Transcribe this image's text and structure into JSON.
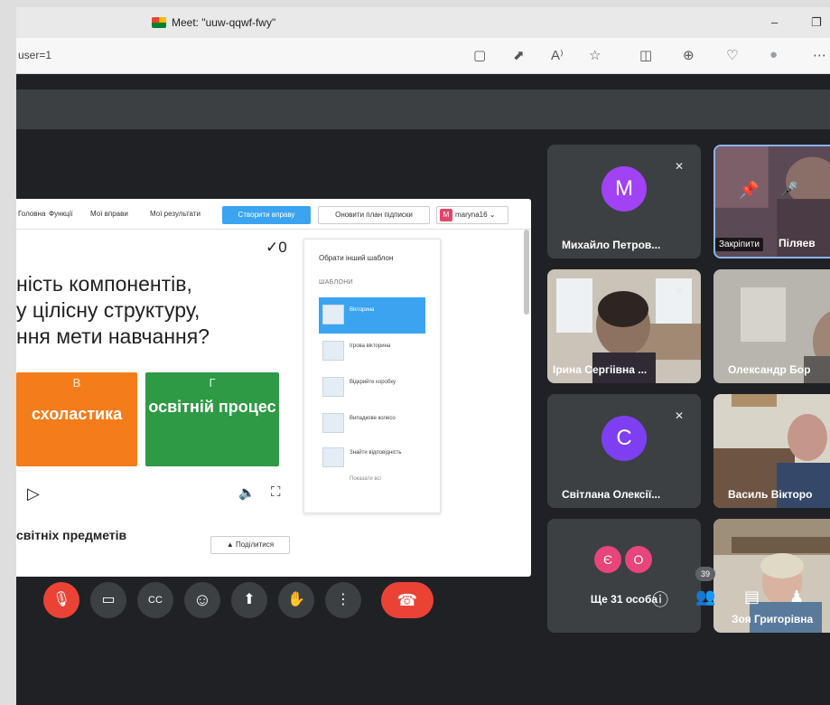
{
  "browser": {
    "tab_title": "Meet: \"uuw-qqwf-fwy\"",
    "url": "user=1",
    "window_minimize": "–",
    "window_restore": "❐",
    "toolbar_icons": [
      "camera-icon",
      "external-icon",
      "read-aloud-icon",
      "favorite-icon",
      "split-screen-icon",
      "collections-icon",
      "extensions-icon",
      "profile-icon",
      "more-icon"
    ],
    "toolbar_glyphs": [
      "▢",
      "⬈",
      "A⁾",
      "☆",
      "◫",
      "⊕",
      "♡",
      "●",
      "⋯"
    ]
  },
  "presentation": {
    "nav": [
      "Головна",
      "Функції",
      "Мої вправи",
      "Мої результати"
    ],
    "create_button": "Створити вправу",
    "update_button": "Оновити план підписки",
    "user_initial": "M",
    "user_name": "maryna16",
    "score": "✓0",
    "question_lines": [
      "ність компонентів,",
      "у цілісну структуру,",
      "ння мети навчання?"
    ],
    "answers": [
      {
        "letter": "В",
        "text": "схоластика",
        "color": "#f47c1a"
      },
      {
        "letter": "Г",
        "text": "освітній процес",
        "color": "#2e9a45"
      }
    ],
    "play_icon": "▷",
    "volume_icon": "🔈",
    "fullscreen_icon": "⛶",
    "subject_text": "світніх предметів",
    "share_button": "Поділитися",
    "template_panel": {
      "heading": "Обрати інший шаблон",
      "section": "ШАБЛОНИ",
      "templates": [
        "Вікторина",
        "Ігрова вікторина",
        "Відкрийте коробку",
        "Випадкове колесо",
        "Знайти відповідність"
      ],
      "show_all": "Показати всі"
    }
  },
  "participants": [
    {
      "name": "Михайло Петров...",
      "initial": "M",
      "avatar_color": "#a142f4"
    },
    {
      "name": "Піляев",
      "pin_label": "Закріпити"
    },
    {
      "name": "Ірина Сергіівна ..."
    },
    {
      "name": "Олександр Бор"
    },
    {
      "name": "Світлана Олексії...",
      "initial": "C",
      "avatar_color": "#7e3ff2"
    },
    {
      "name": "Василь Вікторо"
    },
    {
      "name": "Ще 31 особа",
      "more_initials": [
        "Є",
        "О"
      ],
      "more_colors": [
        "#e8457a",
        "#e8457a"
      ]
    },
    {
      "name": "Зоя Григорівна"
    }
  ],
  "controls": {
    "mic_icon": "🎙",
    "camera_icon": "▭",
    "captions_icon": "CC",
    "emoji_icon": "☺",
    "present_icon": "⬆",
    "raise_hand_icon": "✋",
    "more_icon": "⋮",
    "end_call_icon": "☎",
    "info_icon": "ⓘ",
    "people_icon": "👥",
    "chat_icon": "▤",
    "activities_icon": "♟",
    "people_count": "39"
  },
  "colors": {
    "meet_bg": "#202124",
    "tile_bg": "#3c4043",
    "red": "#ea4335",
    "accent_blue": "#3aa4f0"
  }
}
